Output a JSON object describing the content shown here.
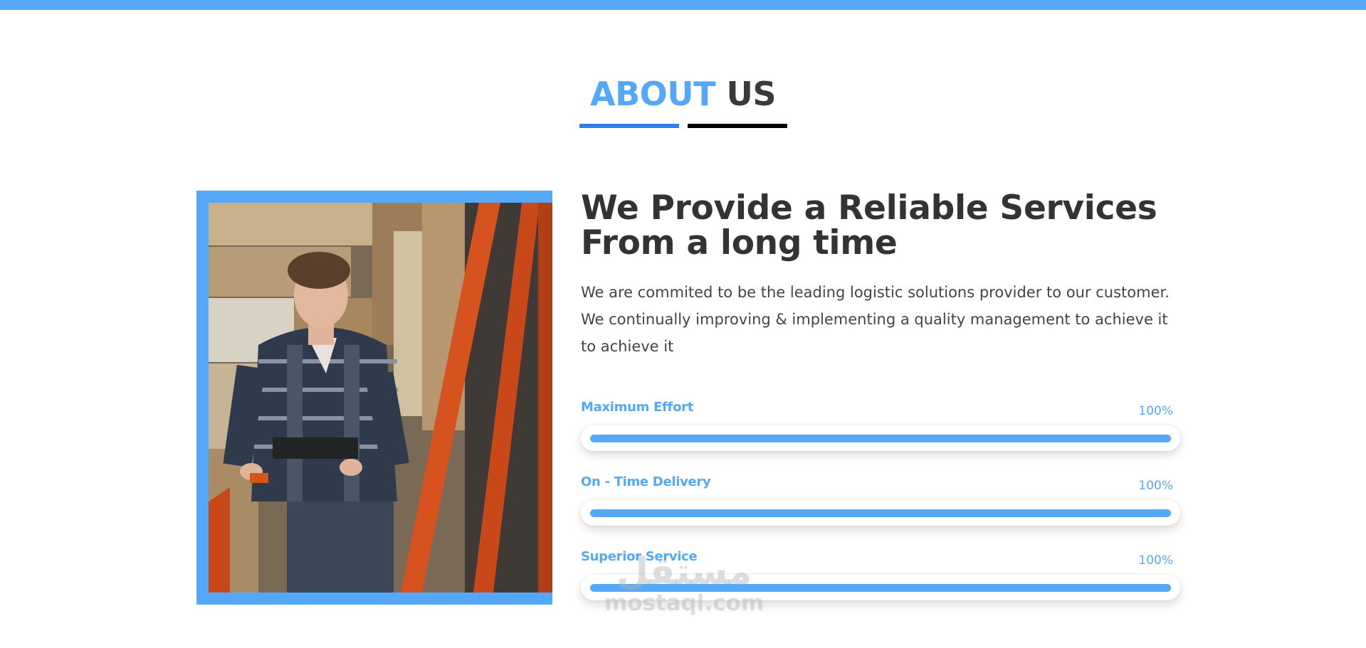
{
  "colors": {
    "accent": "#55a8f8",
    "accent_dark": "#2f80ed",
    "heading": "#333333",
    "body_text": "#444444"
  },
  "section": {
    "title_accent": "ABOUT",
    "title_rest": "US"
  },
  "about": {
    "headline_line1": "We Provide a Reliable Services",
    "headline_line2": "From a long time",
    "intro": "We are commited to be the leading logistic solutions provider to our customer. We continually improving & implementing a quality management to achieve it to achieve it",
    "photo_icon": "warehouse-worker-photo"
  },
  "skills": [
    {
      "label": "Maximum Effort",
      "percent_text": "100%",
      "value": 1.0
    },
    {
      "label": "On - Time Delivery",
      "percent_text": "100%",
      "value": 1.0
    },
    {
      "label": "Superior Service",
      "percent_text": "100%",
      "value": 1.0
    }
  ],
  "watermark": {
    "arabic": "مستقل",
    "latin": "mostaql.com"
  }
}
